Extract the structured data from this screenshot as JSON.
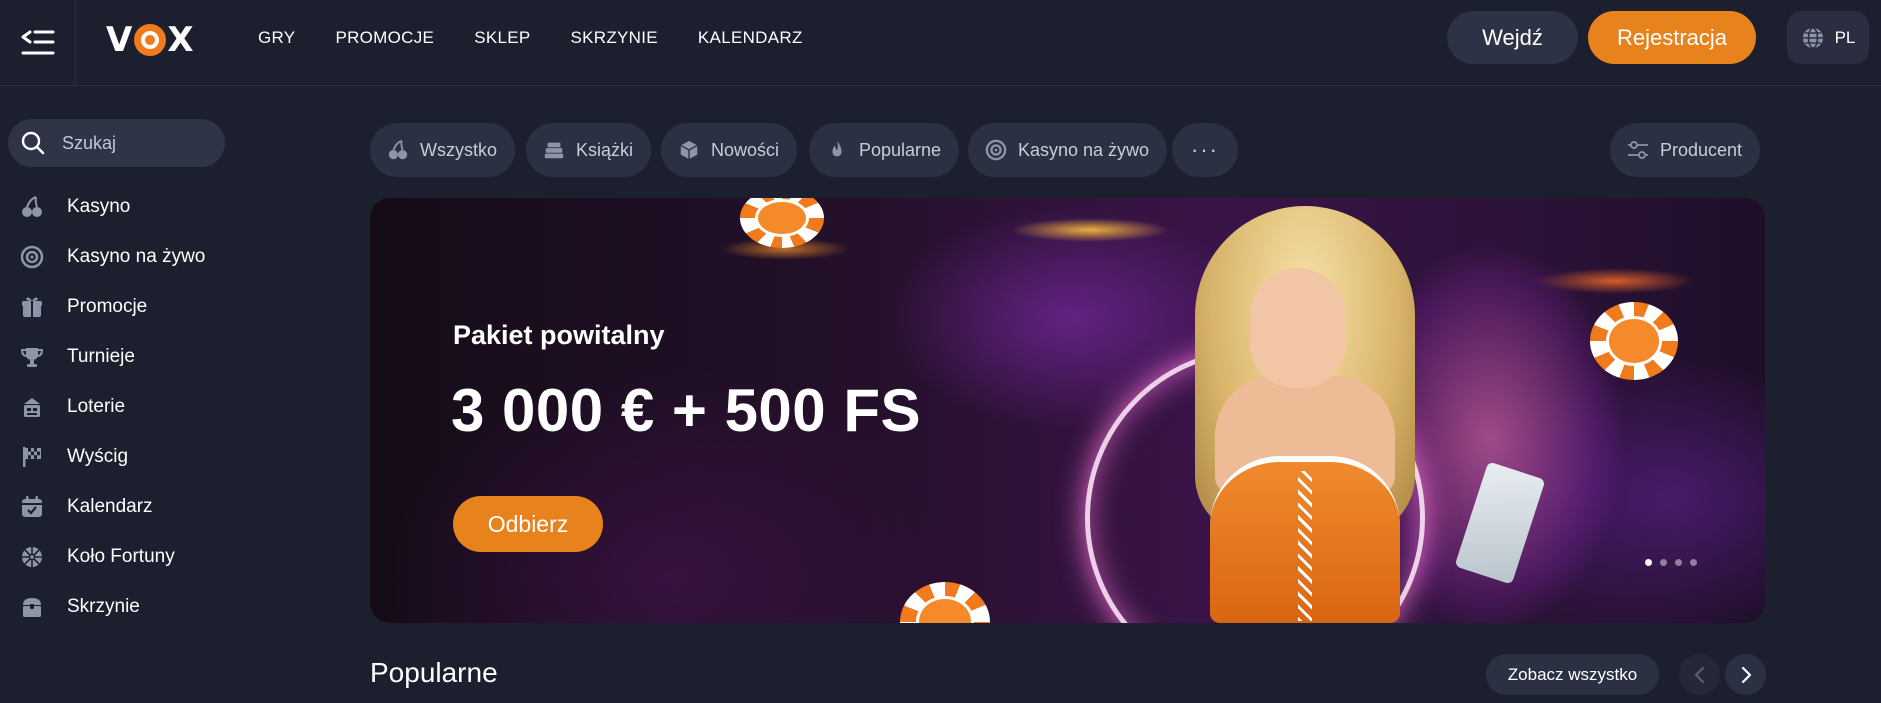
{
  "header": {
    "logo_text": "VOX",
    "nav": [
      "GRY",
      "PROMOCJE",
      "SKLEP",
      "SKRZYNIE",
      "KALENDARZ"
    ],
    "login_label": "Wejdź",
    "register_label": "Rejestracja",
    "language": "PL"
  },
  "sidebar": {
    "search_placeholder": "Szukaj",
    "items": [
      {
        "label": "Kasyno",
        "icon": "cherries-icon"
      },
      {
        "label": "Kasyno na żywo",
        "icon": "roulette-icon"
      },
      {
        "label": "Promocje",
        "icon": "gift-icon"
      },
      {
        "label": "Turnieje",
        "icon": "trophy-icon"
      },
      {
        "label": "Loterie",
        "icon": "lottery-icon"
      },
      {
        "label": "Wyścig",
        "icon": "race-flag-icon"
      },
      {
        "label": "Kalendarz",
        "icon": "calendar-icon"
      },
      {
        "label": "Koło Fortuny",
        "icon": "wheel-icon"
      },
      {
        "label": "Skrzynie",
        "icon": "chest-icon"
      }
    ]
  },
  "categories": {
    "items": [
      {
        "label": "Wszystko",
        "icon": "cherries-icon"
      },
      {
        "label": "Książki",
        "icon": "books-icon"
      },
      {
        "label": "Nowości",
        "icon": "cube-icon"
      },
      {
        "label": "Popularne",
        "icon": "fire-icon"
      },
      {
        "label": "Kasyno na żywo",
        "icon": "roulette-icon"
      }
    ],
    "more_label": "···",
    "provider_label": "Producent"
  },
  "banner": {
    "subtitle": "Pakiet powitalny",
    "title": "3 000 € + 500 FS",
    "cta_label": "Odbierz",
    "slides_count": 4,
    "active_slide": 1
  },
  "section": {
    "title": "Popularne",
    "see_all_label": "Zobacz wszystko"
  },
  "colors": {
    "background": "#1c1f2e",
    "accent": "#e8821d",
    "pill": "#2b3043"
  }
}
